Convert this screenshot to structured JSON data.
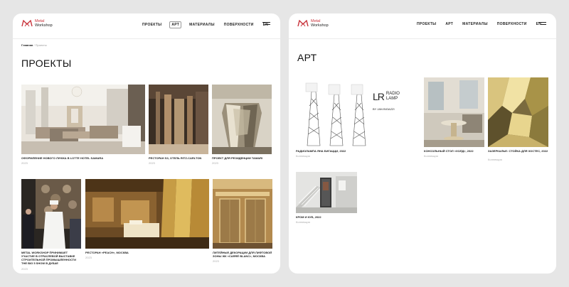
{
  "brand": {
    "line1": "Metal",
    "line2": "Workshop"
  },
  "nav": [
    {
      "label": "ПРОЕКТЫ"
    },
    {
      "label": "АРТ"
    },
    {
      "label": "МАТЕРИАЛЫ"
    },
    {
      "label": "ПОВЕРХНОСТИ"
    },
    {
      "label": "EN"
    }
  ],
  "left": {
    "breadcrumb": {
      "home": "Главная",
      "sep": "/",
      "current": "Проекты"
    },
    "title": "ПРОЕКТЫ",
    "cards": [
      {
        "caption": "ОФОРМЛЕНИЕ НОВОГО ЛУНЖА В LOTTE HOTEL SAMARA",
        "year": "2023"
      },
      {
        "caption": "РЕСТОРАН S3, ОТЕЛЬ RITZ-CARLTON",
        "year": "2023"
      },
      {
        "caption": "ПРОЕКТ ДЛЯ РЕЗИДЕНЦИИ TAMARI",
        "year": "2023"
      },
      {
        "caption": "METAL WORKSHOP ПРИНИМАЕТ УЧАСТИЕ В ОТРАСЛЕВОЙ ВЫСТАВКЕ СТРОИТЕЛЬНОЙ ПРОМЫШЛЕННОСТИ THE BIG 5 SHOW В ДУБАЕ",
        "year": "2023"
      },
      {
        "caption": "РЕСТОРАН «PEACH», МОСКВА",
        "year": "2023"
      },
      {
        "caption": "ЛИТЕЙНЫЕ ДЕКОРАЦИИ ДЛЯ ЛИФТОВОЙ ЗОНЫ ЖК «CARRÉ BLANC», МОСКВА",
        "year": "2023"
      }
    ]
  },
  "right": {
    "title": "АРТ",
    "cards": [
      {
        "caption": "РАДИОЛАМПА ЯНА БИГАЦЦИ, 2022",
        "year": "Коллекция"
      },
      {
        "caption": "КОНСОЛЬНЫЙ СТОЛ «ХОЛД», 2022",
        "year": "Коллекция"
      },
      {
        "caption": "ЗАЗЕРКАЛЬЕ: СТОЙКА ДЛЯ ХОСТЕС, 2022",
        "year": "Коллекция"
      },
      {
        "caption": "КРОМ И КУБ, 2022",
        "year": "Коллекция"
      }
    ],
    "radio_lamp": {
      "l1": "LR",
      "l2": "RADIO",
      "l3": "LAMP",
      "by": "BY JAN BIGAZZI"
    }
  }
}
